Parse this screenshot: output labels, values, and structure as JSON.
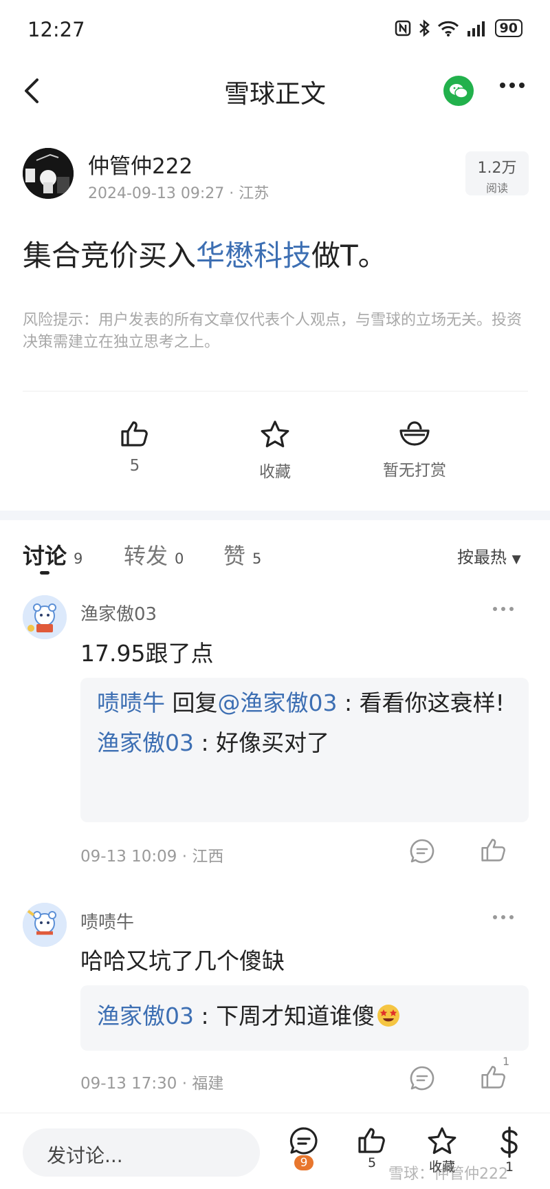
{
  "status_bar": {
    "time": "12:27",
    "battery": "90"
  },
  "header": {
    "title": "雪球正文"
  },
  "author": {
    "name": "仲管仲222",
    "datetime": "2024-09-13 09:27",
    "region": "江苏",
    "reads_num": "1.2万",
    "reads_label": "阅读"
  },
  "post": {
    "prefix": "集合竞价买入",
    "stock": "华懋科技",
    "suffix": "做T。"
  },
  "risk_notice": "风险提示：用户发表的所有文章仅代表个人观点，与雪球的立场无关。投资决策需建立在独立思考之上。",
  "actions": {
    "like_count": "5",
    "favorite_label": "收藏",
    "reward_label": "暂无打赏"
  },
  "tabs": [
    {
      "label": "讨论",
      "count": "9"
    },
    {
      "label": "转发",
      "count": "0"
    },
    {
      "label": "赞",
      "count": "5"
    }
  ],
  "sort_label": "按最热",
  "comments": [
    {
      "user": "渔家傲03",
      "text": "17.95跟了点",
      "replies": [
        {
          "user": "啧啧牛",
          "reply_word": "回复",
          "mention": "@渔家傲03",
          "sep": " : ",
          "text": "看看你这衰样!"
        },
        {
          "user": "渔家傲03",
          "sep": " : ",
          "text": "好像买对了"
        }
      ],
      "time": "09-13 10:09",
      "region": "江西",
      "likes": ""
    },
    {
      "user": "啧啧牛",
      "text": "哈哈又坑了几个傻缺",
      "replies": [
        {
          "user": "渔家傲03",
          "sep": " : ",
          "text": "下周才知道谁傻"
        }
      ],
      "time": "09-13 17:30",
      "region": "福建",
      "likes": "1"
    }
  ],
  "bottom_bar": {
    "input_placeholder": "发讨论...",
    "comment_badge": "9",
    "like_count": "5",
    "favorite_label": "收藏",
    "reward_count": "1"
  },
  "watermark": "雪球：仲管仲222"
}
